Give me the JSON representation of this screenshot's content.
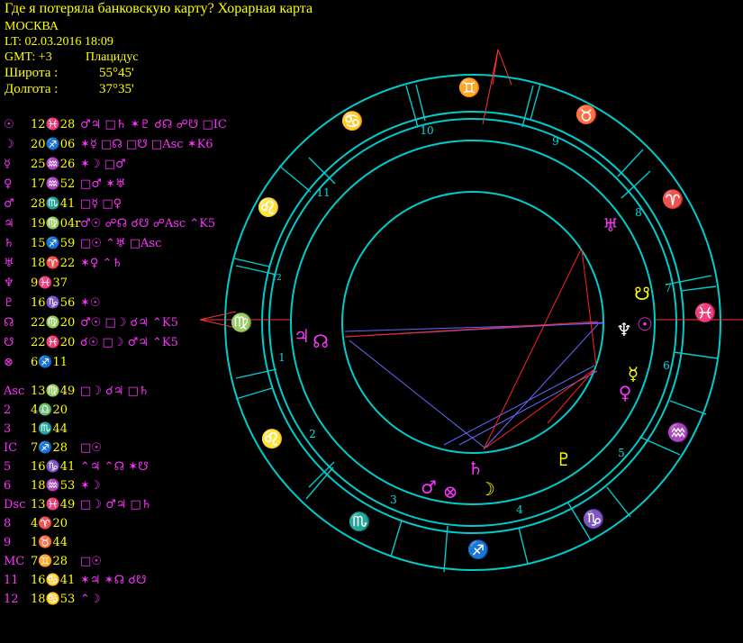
{
  "header": {
    "title": "Где я потеряла банковскую карту? Хорарная карта",
    "city": "МОСКВА",
    "lt": "LT: 02.03.2016  18:09",
    "gmt": "GMT: +3",
    "house_system": "Плацидус",
    "lat_label": "Широта :",
    "lat_value": "55°45'",
    "lon_label": "Долгота :",
    "lon_value": "37°35'"
  },
  "planets": [
    {
      "glyph": "☉",
      "pos": "12♓28",
      "aspects": "♂♃ □♄ ✶♇ ☌☊ ☍☋ □IC"
    },
    {
      "glyph": "☽",
      "pos": "20♐06",
      "aspects": "✶☿ □☊ □☋ □Asc ✶K6"
    },
    {
      "glyph": "☿",
      "pos": "25♒26",
      "aspects": "✶☽ □♂"
    },
    {
      "glyph": "♀",
      "pos": "17♒52",
      "aspects": "□♂ ✶♅"
    },
    {
      "glyph": "♂",
      "pos": "28♏41",
      "aspects": "□☿ □♀"
    },
    {
      "glyph": "♃",
      "pos": "19♍04r",
      "aspects": "♂☉ ☍☊ ☌☋ ☍Asc ⌃K5"
    },
    {
      "glyph": "♄",
      "pos": "15♐59",
      "aspects": "□☉ ⌃♅ □Asc"
    },
    {
      "glyph": "♅",
      "pos": "18♈22",
      "aspects": "✶♀ ⌃♄"
    },
    {
      "glyph": "♆",
      "pos": "9♓37",
      "aspects": ""
    },
    {
      "glyph": "♇",
      "pos": "16♑56",
      "aspects": "✶☉"
    },
    {
      "glyph": "☊",
      "pos": "22♍20",
      "aspects": "♂☉ □☽ ☌♃ ⌃K5"
    },
    {
      "glyph": "☋",
      "pos": "22♓20",
      "aspects": "☌☉ □☽ ♂♃ ⌃K5"
    },
    {
      "glyph": "⊗",
      "pos": "6♐11",
      "aspects": ""
    }
  ],
  "houses": [
    {
      "label": "Asc",
      "pos": "13♍49",
      "aspects": "□☽ ☌♃ □♄"
    },
    {
      "label": "2",
      "pos": "4♎20",
      "aspects": ""
    },
    {
      "label": "3",
      "pos": "1♏44",
      "aspects": ""
    },
    {
      "label": "IC",
      "pos": "7♐28",
      "aspects": "□☉"
    },
    {
      "label": "5",
      "pos": "16♑41",
      "aspects": "⌃♃ ⌃☊ ✶☋"
    },
    {
      "label": "6",
      "pos": "18♒53",
      "aspects": "✶☽"
    },
    {
      "label": "Dsc",
      "pos": "13♓49",
      "aspects": "□☽ ♂♃ □♄"
    },
    {
      "label": "8",
      "pos": "4♈20",
      "aspects": ""
    },
    {
      "label": "9",
      "pos": "1♉44",
      "aspects": ""
    },
    {
      "label": "MC",
      "pos": "7♊28",
      "aspects": "□☉"
    },
    {
      "label": "11",
      "pos": "16♋41",
      "aspects": "✶♃ ✶☊ ☌☋"
    },
    {
      "label": "12",
      "pos": "18♋53",
      "aspects": "⌃☽"
    }
  ],
  "wheel": {
    "zodiac_signs": [
      {
        "glyph": "♍",
        "name": "virgo",
        "color": "#ffff00"
      },
      {
        "glyph": "♎",
        "name": "libra",
        "color": "#ffff00"
      },
      {
        "glyph": "♏",
        "name": "scorpio",
        "color": "#ffff00"
      },
      {
        "glyph": "♐",
        "name": "sagittarius",
        "color": "#ffff00"
      },
      {
        "glyph": "♑",
        "name": "capricorn",
        "color": "#ffff00"
      },
      {
        "glyph": "♒",
        "name": "aquarius",
        "color": "#ffff00"
      },
      {
        "glyph": "♓",
        "name": "pisces",
        "color": "#ffffff"
      },
      {
        "glyph": "♈",
        "name": "aries",
        "color": "#ffff00"
      },
      {
        "glyph": "♉",
        "name": "taurus",
        "color": "#ffff00"
      },
      {
        "glyph": "♊",
        "name": "gemini",
        "color": "#ffff00"
      },
      {
        "glyph": "♋",
        "name": "cancer",
        "color": "#ffff00"
      },
      {
        "glyph": "♌",
        "name": "leo",
        "color": "#ffff00"
      }
    ],
    "house_numbers": [
      "1",
      "2",
      "3",
      "4",
      "5",
      "6",
      "7",
      "8",
      "9",
      "10",
      "11",
      "12"
    ],
    "planet_glyphs": {
      "jupiter": "♃",
      "north-node": "☊",
      "neptune": "♆",
      "sun": "☉",
      "south-node": "☋",
      "uranus": "♅",
      "mercury": "☿",
      "venus": "♀",
      "pluto": "♇",
      "saturn": "♄",
      "mars": "♂",
      "part-of-fortune": "⊗",
      "moon": "☽"
    },
    "colors": {
      "ring": "#00cccc",
      "planet": "#ff33ff",
      "sign": "#ffff00",
      "arrow": "#ff3333",
      "aspect_red": "#ff2222",
      "aspect_blue": "#6666ff",
      "house_num": "#00dddd"
    }
  }
}
